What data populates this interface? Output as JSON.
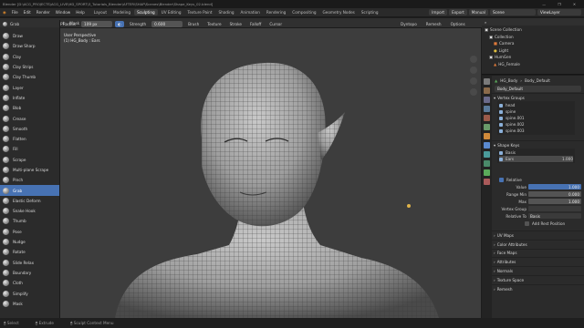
{
  "titlebar": {
    "text": "Blender [D:\\ACG_PROJECTS\\ACG_LIVE\\HD_SPORT\\3_Tutorials_Blender\\AFTER\\SHAP\\Scenes\\Blender\\Shape_Keys_02.blend]"
  },
  "menubar": {
    "mode": "Sculpt Mode",
    "menus": [
      "View",
      "Sculpt",
      "Mask",
      "Face Sets"
    ],
    "app_menus": [
      "File",
      "Edit",
      "Render",
      "Window",
      "Help"
    ],
    "workspaces": [
      "Layout",
      "Modeling",
      "Sculpting",
      "UV Editing",
      "Texture Paint",
      "Shading",
      "Animation",
      "Rendering",
      "Compositing",
      "Geometry Nodes",
      "Scripting"
    ],
    "active_workspace": "Sculpting",
    "right_buttons": [
      "Import",
      "Export",
      "Manual"
    ],
    "scene": "Scene",
    "view_layer": "ViewLayer"
  },
  "toolbar": {
    "brush": "Grab",
    "radius_label": "Radius",
    "radius_value": "109 px",
    "strength_label": "Strength",
    "strength_value": "0.600",
    "menus": [
      "Brush",
      "Texture",
      "Stroke",
      "Falloff",
      "Cursor"
    ],
    "right": [
      "Dyntopo",
      "Remesh",
      "Options"
    ]
  },
  "brushes": [
    "Draw",
    "Draw Sharp",
    "Clay",
    "Clay Strips",
    "Clay Thumb",
    "Layer",
    "Inflate",
    "Blob",
    "Crease",
    "Smooth",
    "Flatten",
    "Fill",
    "Scrape",
    "Multi-plane Scrape",
    "Pinch",
    "Grab",
    "Elastic Deform",
    "Snake Hook",
    "Thumb",
    "Pose",
    "Nudge",
    "Rotate",
    "Slide Relax",
    "Boundary",
    "Cloth",
    "Simplify",
    "Mask"
  ],
  "active_brush": "Grab",
  "viewport": {
    "view_name": "User Perspective",
    "object_info": "(1) HG_Body : Ears"
  },
  "outliner": {
    "title": "Scene Collection",
    "items": [
      "Collection",
      "Camera",
      "Light",
      "HumGen",
      "HG_Female"
    ]
  },
  "props": {
    "breadcrumb": [
      "HG_Body",
      "Body_Default"
    ],
    "mesh_name": "Body_Default",
    "vertex_groups_title": "Vertex Groups",
    "vertex_groups": [
      "head",
      "spine",
      "spine.001",
      "spine.002",
      "spine.003"
    ],
    "shape_keys_title": "Shape Keys",
    "shape_keys": [
      {
        "name": "Basis",
        "value": ""
      },
      {
        "name": "Ears",
        "value": "1.000"
      }
    ],
    "relative_label": "Relative",
    "value_label": "Value",
    "value": "1.000",
    "range_min_label": "Range Min",
    "range_min": "0.000",
    "max_label": "Max",
    "max": "1.000",
    "vertex_group_label": "Vertex Group",
    "relative_to_label": "Relative To",
    "relative_to": "Basis",
    "add_rest_label": "Add Rest Position",
    "collapsed_sections": [
      "UV Maps",
      "Color Attributes",
      "Face Maps",
      "Attributes",
      "Normals",
      "Texture Space",
      "Remesh"
    ]
  },
  "statusbar": {
    "items": [
      "Select",
      "Extrude",
      "Sculpt Context Menu"
    ]
  },
  "colors": {
    "accent": "#4772b3",
    "viewport_bg": "#3d3d3d",
    "panel_bg": "#2b2b2b",
    "header_bg": "#303030"
  }
}
